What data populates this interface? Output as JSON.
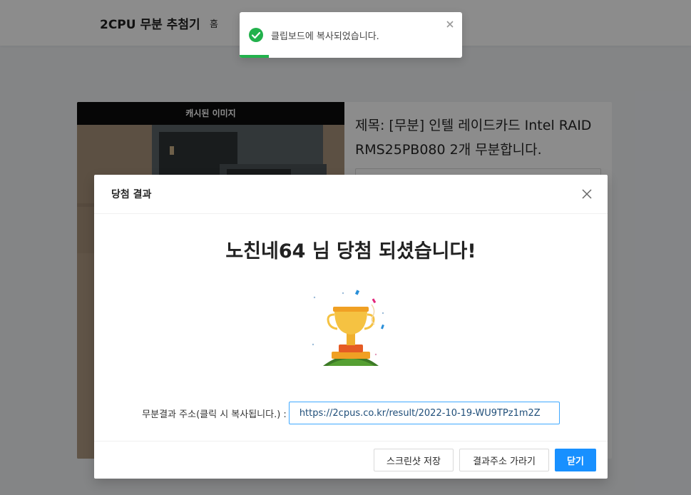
{
  "header": {
    "brand": "2CPU 무분 추첨기",
    "nav_home": "홈"
  },
  "card": {
    "image_banner": "캐시된 이미지",
    "title": "제목: [무분] 인텔 레이드카드 Intel RAID RMS25PB080 2개 무분합니다."
  },
  "modal": {
    "title": "당첨 결과",
    "win_message": "노친네64 님 당첨 되셨습니다!",
    "url_label": "무분결과 주소(클릭 시 복사됩니다.) :",
    "url_value": "https://2cpus.co.kr/result/2022-10-19-WU9TPz1m2Z",
    "buttons": {
      "screenshot": "스크린샷 저장",
      "hide_url": "결과주소 가라기",
      "close": "닫기"
    }
  },
  "toast": {
    "message": "클립보드에 복사되었습니다.",
    "progress": 0.13
  },
  "colors": {
    "primary": "#1890ff",
    "success": "#22b14c",
    "trophy_gold": "#f5c242",
    "grass": "#3d7a27"
  }
}
